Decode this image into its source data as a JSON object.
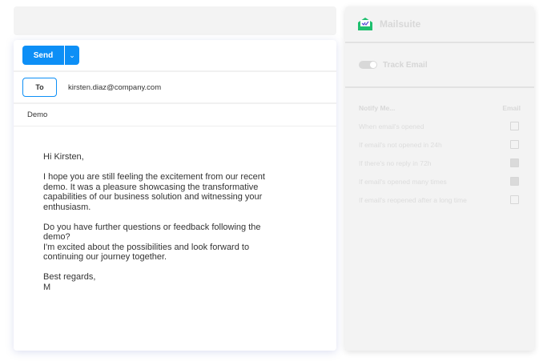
{
  "compose": {
    "send_label": "Send",
    "to_label": "To",
    "recipient": "kirsten.diaz@company.com",
    "subject": "Demo",
    "body": [
      "Hi Kirsten,",
      "I hope you are still feeling the excitement from our recent demo. It was a pleasure showcasing the transformative capabilities of our business solution and witnessing your enthusiasm.",
      "Do you have further questions or feedback following the demo?",
      "I'm excited about the possibilities and look forward to continuing our journey together.",
      "Best regards,",
      "M"
    ]
  },
  "panel": {
    "brand": "Mailsuite",
    "track_label": "Track Email",
    "track_enabled": true,
    "notify_header": "Notify Me...",
    "email_header": "Email",
    "rows": [
      {
        "label": "When email's opened",
        "checked": false
      },
      {
        "label": "If email's not opened in 24h",
        "checked": false
      },
      {
        "label": "If there's no reply in 72h",
        "checked": true
      },
      {
        "label": "If email's opened many times",
        "checked": true
      },
      {
        "label": "If email's reopened after a long time",
        "checked": false
      }
    ]
  }
}
